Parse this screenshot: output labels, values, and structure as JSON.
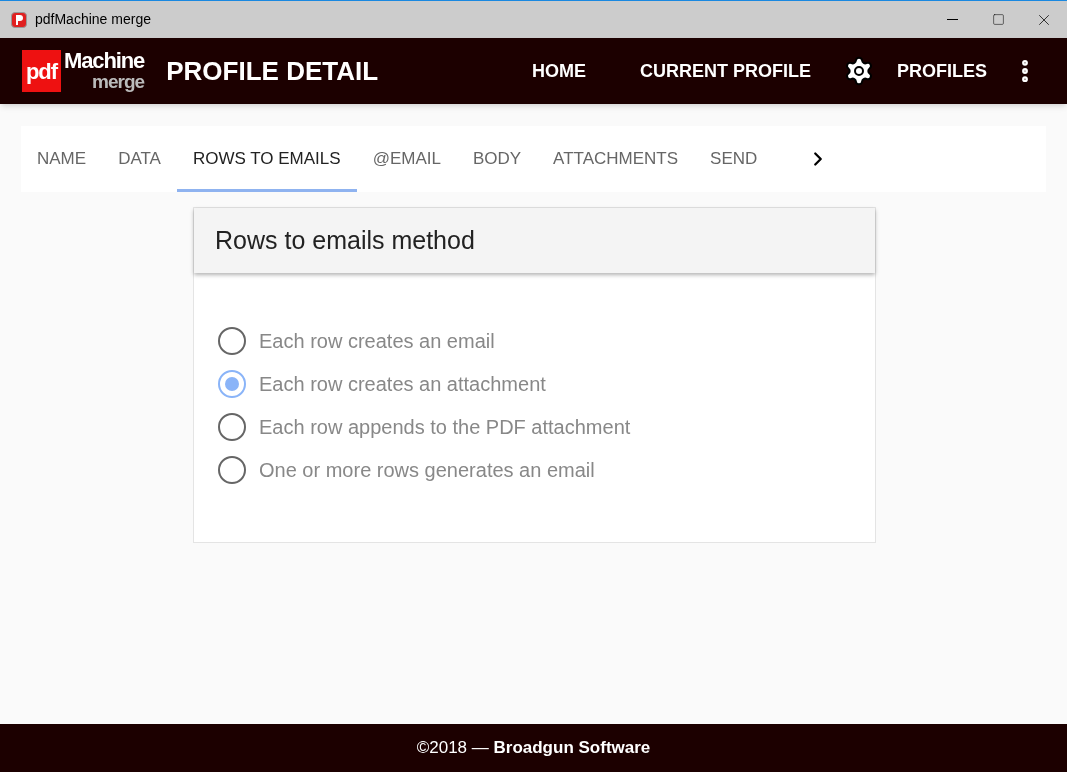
{
  "window": {
    "title": "pdfMachine merge"
  },
  "logo": {
    "badge": "pdf",
    "name": "Machine",
    "sub": "merge"
  },
  "header": {
    "title": "PROFILE DETAIL",
    "nav": [
      "HOME",
      "CURRENT PROFILE"
    ],
    "profiles": "PROFILES"
  },
  "tabs": [
    {
      "label": "NAME",
      "selected": false
    },
    {
      "label": "DATA",
      "selected": false
    },
    {
      "label": "ROWS TO EMAILS",
      "selected": true
    },
    {
      "label": "@EMAIL",
      "selected": false
    },
    {
      "label": "BODY",
      "selected": false
    },
    {
      "label": "ATTACHMENTS",
      "selected": false
    },
    {
      "label": "SEND",
      "selected": false
    }
  ],
  "card": {
    "title": "Rows to emails method",
    "options": [
      {
        "label": "Each row creates an email",
        "selected": false
      },
      {
        "label": "Each row creates an attachment",
        "selected": true
      },
      {
        "label": "Each row appends to the PDF attachment",
        "selected": false
      },
      {
        "label": "One or more rows generates an email",
        "selected": false
      }
    ]
  },
  "footer": "©2018 — **Broadgun Software**"
}
